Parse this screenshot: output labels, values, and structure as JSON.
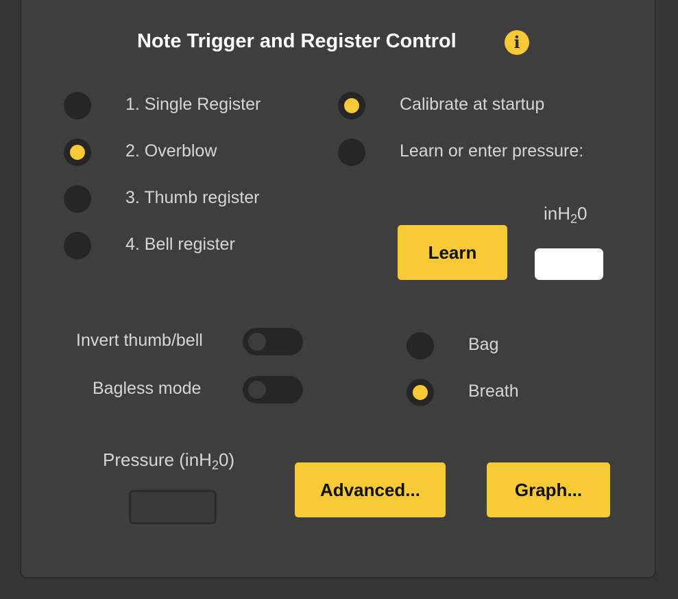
{
  "header": {
    "title": "Note Trigger and Register Control",
    "info_icon": "info-icon"
  },
  "register_modes": [
    {
      "label": "1. Single Register",
      "checked": false
    },
    {
      "label": "2. Overblow",
      "checked": true
    },
    {
      "label": "3. Thumb register",
      "checked": false
    },
    {
      "label": "4. Bell register",
      "checked": false
    }
  ],
  "calibration": {
    "options": [
      {
        "label": "Calibrate at startup",
        "checked": true
      },
      {
        "label": "Learn or enter pressure:",
        "checked": false
      }
    ],
    "unit_main": "inH",
    "unit_sub": "2",
    "unit_tail": "0",
    "learn_label": "Learn",
    "pressure_value": ""
  },
  "toggles": {
    "invert_label": "Invert thumb/bell",
    "invert_on": false,
    "bagless_label": "Bagless mode",
    "bagless_on": false
  },
  "source_modes": [
    {
      "label": "Bag",
      "checked": false
    },
    {
      "label": "Breath",
      "checked": true
    }
  ],
  "pressure_readout": {
    "label_main": "Pressure (inH",
    "label_sub": "2",
    "label_tail": "0)",
    "value": ""
  },
  "buttons": {
    "advanced_label": "Advanced...",
    "graph_label": "Graph..."
  },
  "colors": {
    "accent": "#f6c935",
    "background": "#363636",
    "panel": "#3e3e3e",
    "control_dark": "#262626"
  }
}
